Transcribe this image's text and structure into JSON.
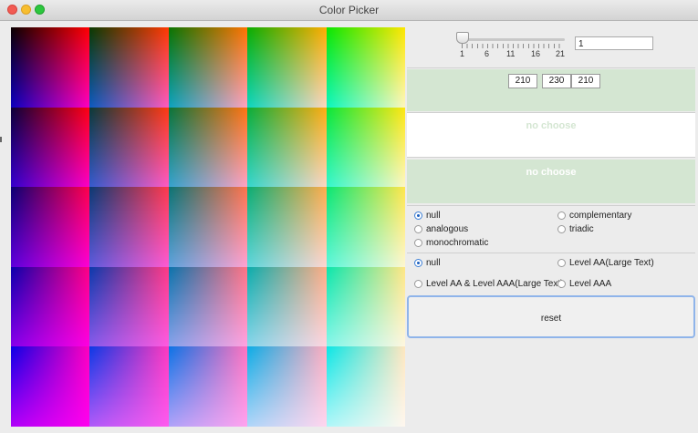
{
  "window": {
    "title": "Color Picker",
    "controls": [
      "close",
      "minimize",
      "maximize"
    ]
  },
  "slider": {
    "tick_labels": [
      "1",
      "6",
      "11",
      "16",
      "21"
    ],
    "value": "1"
  },
  "rgb": {
    "r": "210",
    "g": "230",
    "b": "210",
    "panel_color": "#d2e6d2"
  },
  "selection": {
    "primary_label": "no choose",
    "secondary_label": "no choose"
  },
  "harmony": {
    "options": [
      "null",
      "complementary",
      "analogous",
      "triadic",
      "monochromatic"
    ],
    "selected": "null"
  },
  "contrast": {
    "options": [
      "null",
      "Level AA(Large Text)",
      "Level AA & Level AAA(Large Text)",
      "Level AAA"
    ],
    "selected": "null"
  },
  "reset_label": "reset",
  "palette": {
    "rows": 5,
    "cols": 5,
    "description_colors": {
      "accent": "#3c7fd6",
      "panel_green": "#d4e6d2"
    }
  }
}
